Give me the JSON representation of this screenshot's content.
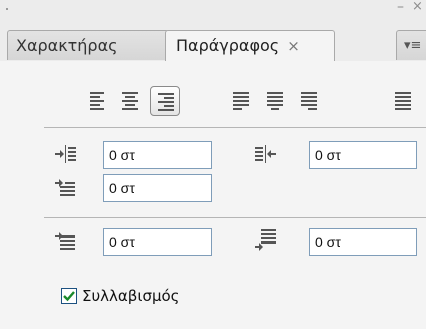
{
  "panel": {
    "tabs": [
      {
        "label": "Χαρακτήρας",
        "active": false
      },
      {
        "label": "Παράγραφος",
        "active": true,
        "close_glyph": "×"
      }
    ],
    "window_controls": {
      "minimize": "–",
      "close": "×"
    },
    "menu_icon": "≡"
  },
  "alignment_buttons": [
    {
      "name": "align-left-icon",
      "active": false
    },
    {
      "name": "align-center-icon",
      "active": false
    },
    {
      "name": "align-right-icon",
      "active": true
    },
    {
      "name": "justify-last-left-icon",
      "active": false
    },
    {
      "name": "justify-last-center-icon",
      "active": false
    },
    {
      "name": "justify-last-right-icon",
      "active": false
    },
    {
      "name": "justify-all-icon",
      "active": false
    }
  ],
  "indents": {
    "left_indent": "0 στ",
    "right_indent": "0 στ",
    "first_line_indent": "0 στ"
  },
  "spacing": {
    "space_before": "0 στ",
    "space_after": "0 στ"
  },
  "hyphenate": {
    "label": "Συλλαβισμός",
    "checked": true
  },
  "colors": {
    "checkmark": "#1a8a2a",
    "field_border": "#7f9db9"
  }
}
